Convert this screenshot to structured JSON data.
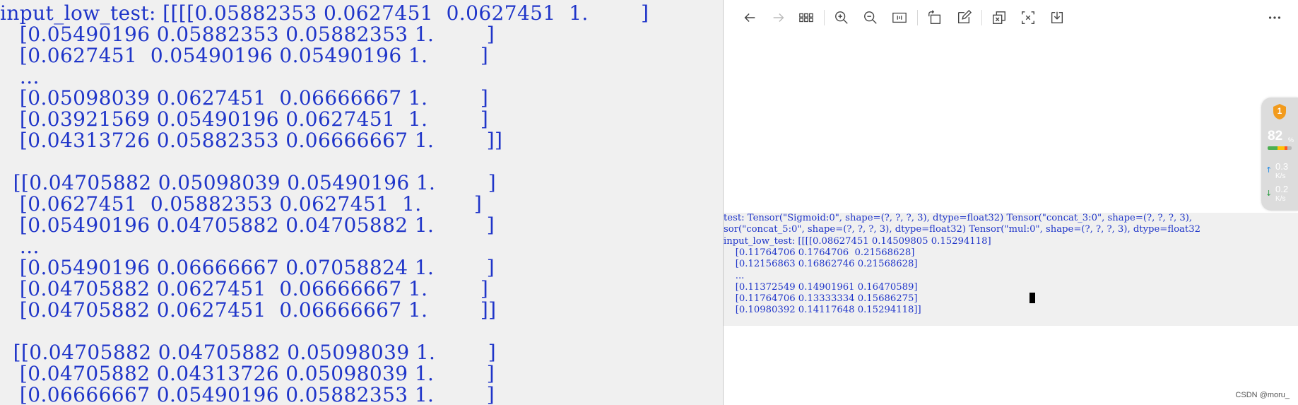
{
  "left_terminal": {
    "lines": [
      "input_low_test: [[[[0.05882353 0.0627451  0.0627451  1.        ]",
      "   [0.05490196 0.05882353 0.05882353 1.        ]",
      "   [0.0627451  0.05490196 0.05490196 1.        ]",
      "   ...",
      "   [0.05098039 0.0627451  0.06666667 1.        ]",
      "   [0.03921569 0.05490196 0.0627451  1.        ]",
      "   [0.04313726 0.05882353 0.06666667 1.        ]]",
      "",
      "  [[0.04705882 0.05098039 0.05490196 1.        ]",
      "   [0.0627451  0.05882353 0.0627451  1.        ]",
      "   [0.05490196 0.04705882 0.04705882 1.        ]",
      "   ...",
      "   [0.05490196 0.06666667 0.07058824 1.        ]",
      "   [0.04705882 0.0627451  0.06666667 1.        ]",
      "   [0.04705882 0.0627451  0.06666667 1.        ]]",
      "",
      "  [[0.04705882 0.04705882 0.05098039 1.        ]",
      "   [0.04705882 0.04313726 0.05098039 1.        ]",
      "   [0.06666667 0.05490196 0.05882353 1.        ]"
    ]
  },
  "viewer": {
    "toolbar": {
      "back_icon": "arrow-left-icon",
      "forward_icon": "arrow-right-icon",
      "grid_icon": "grid-icon",
      "zoom_in_icon": "zoom-in-icon",
      "zoom_out_icon": "zoom-out-icon",
      "fit_icon": "fit-width-icon",
      "rotate_icon": "rotate-icon",
      "edit_icon": "edit-icon",
      "copy_icon": "copy-icon",
      "crop_icon": "crop-icon",
      "save_icon": "download-icon",
      "more_icon": "more-icon"
    },
    "terminal_lines": [
      "test: Tensor(\"Sigmoid:0\", shape=(?, ?, ?, 3), dtype=float32) Tensor(\"concat_3:0\", shape=(?, ?, ?, 3),",
      "sor(\"concat_5:0\", shape=(?, ?, ?, 3), dtype=float32) Tensor(\"mul:0\", shape=(?, ?, ?, 3), dtype=float32",
      "input_low_test: [[[[0.08627451 0.14509805 0.15294118]",
      "    [0.11764706 0.1764706  0.21568628]",
      "    [0.12156863 0.16862746 0.21568628]",
      "    ...",
      "    [0.11372549 0.14901961 0.16470589]",
      "    [0.11764706 0.13333334 0.15686275]",
      "    [0.10980392 0.14117648 0.15294118]]"
    ]
  },
  "widget": {
    "badge": "1",
    "percent": "82",
    "percent_sign": "%",
    "upload_value": "0.3",
    "upload_unit": "K/s",
    "download_value": "0.2",
    "download_unit": "K/s",
    "bar_colors": [
      "#4caf50",
      "#ffc107",
      "#ff5722"
    ],
    "accent": "#f29b1d"
  },
  "watermark": "CSDN @moru_"
}
